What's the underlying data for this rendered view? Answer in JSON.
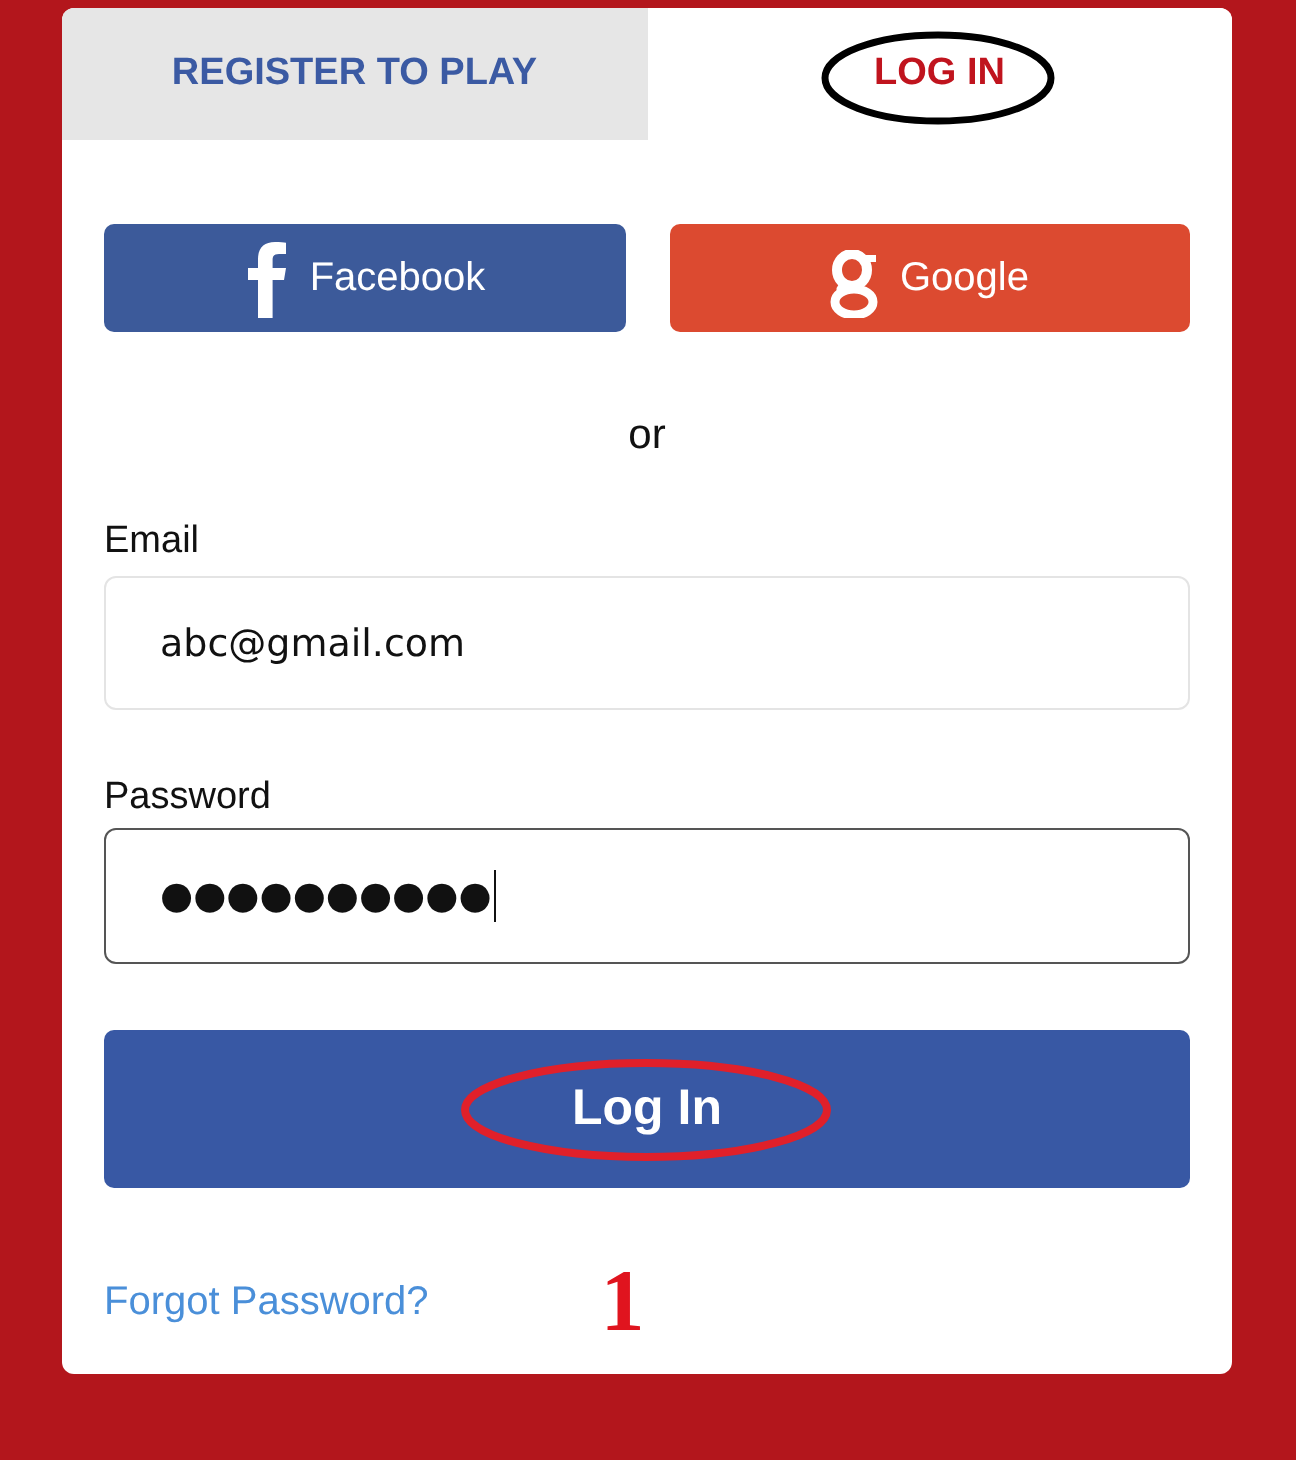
{
  "tabs": [
    {
      "label": "REGISTER TO PLAY",
      "selected": false,
      "circled": false
    },
    {
      "label": "LOG IN",
      "selected": true,
      "circled": true
    }
  ],
  "social_buttons": [
    {
      "kind": "facebook",
      "label": "Facebook"
    },
    {
      "kind": "google",
      "label": "Google"
    }
  ],
  "divider_text": "or",
  "fields": [
    {
      "label": "Email",
      "value": "abc@gmail.com",
      "focused": false
    },
    {
      "label": "Password",
      "value": "●●●●●●●●●●",
      "focused": true
    }
  ],
  "submit_button": {
    "label": "Log In",
    "circled": true
  },
  "forgot_link": "Forgot Password?",
  "annotation_number": "1"
}
